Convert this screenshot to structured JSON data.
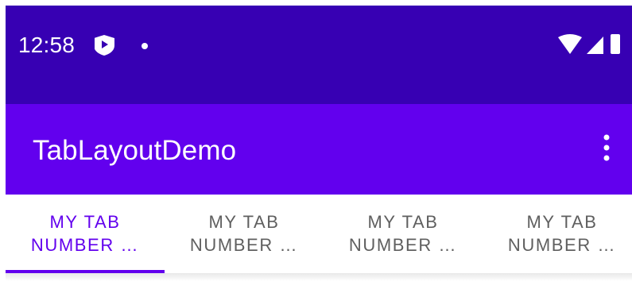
{
  "status_bar": {
    "time": "12:58",
    "left_icons": [
      "shield-play-icon",
      "notification-dot-icon"
    ],
    "right_icons": [
      "wifi-icon",
      "cell-signal-icon",
      "battery-icon"
    ],
    "background": "#3700b3"
  },
  "app_bar": {
    "title": "TabLayoutDemo",
    "menu_icon": "overflow-menu-icon",
    "background": "#6200ee"
  },
  "tabs": [
    {
      "label": "MY TAB\nNUMBER …",
      "selected": true
    },
    {
      "label": "MY TAB\nNUMBER …",
      "selected": false
    },
    {
      "label": "MY TAB\nNUMBER …",
      "selected": false
    },
    {
      "label": "MY TAB\nNUMBER …",
      "selected": false
    }
  ],
  "colors": {
    "accent": "#6200ee",
    "tab_text_inactive": "#5f5f5f"
  }
}
